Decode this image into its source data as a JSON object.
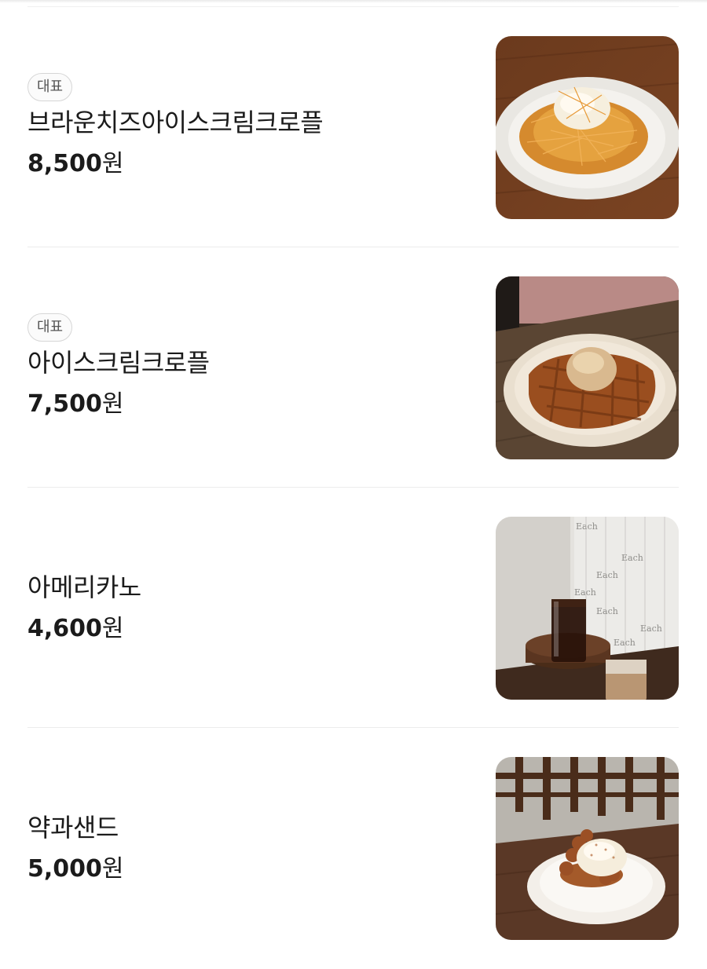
{
  "menu": {
    "items": [
      {
        "badge": "대표",
        "name": "브라운치즈아이스크림크로플",
        "price": "8,500",
        "currency": "원",
        "image_icon": "croffle-brown-cheese-photo"
      },
      {
        "badge": "대표",
        "name": "아이스크림크로플",
        "price": "7,500",
        "currency": "원",
        "image_icon": "croffle-ice-cream-photo"
      },
      {
        "badge": "",
        "name": "아메리카노",
        "price": "4,600",
        "currency": "원",
        "image_icon": "americano-photo",
        "image_text": "Each"
      },
      {
        "badge": "",
        "name": "약과샌드",
        "price": "5,000",
        "currency": "원",
        "image_icon": "yakgwa-sand-photo"
      }
    ]
  }
}
